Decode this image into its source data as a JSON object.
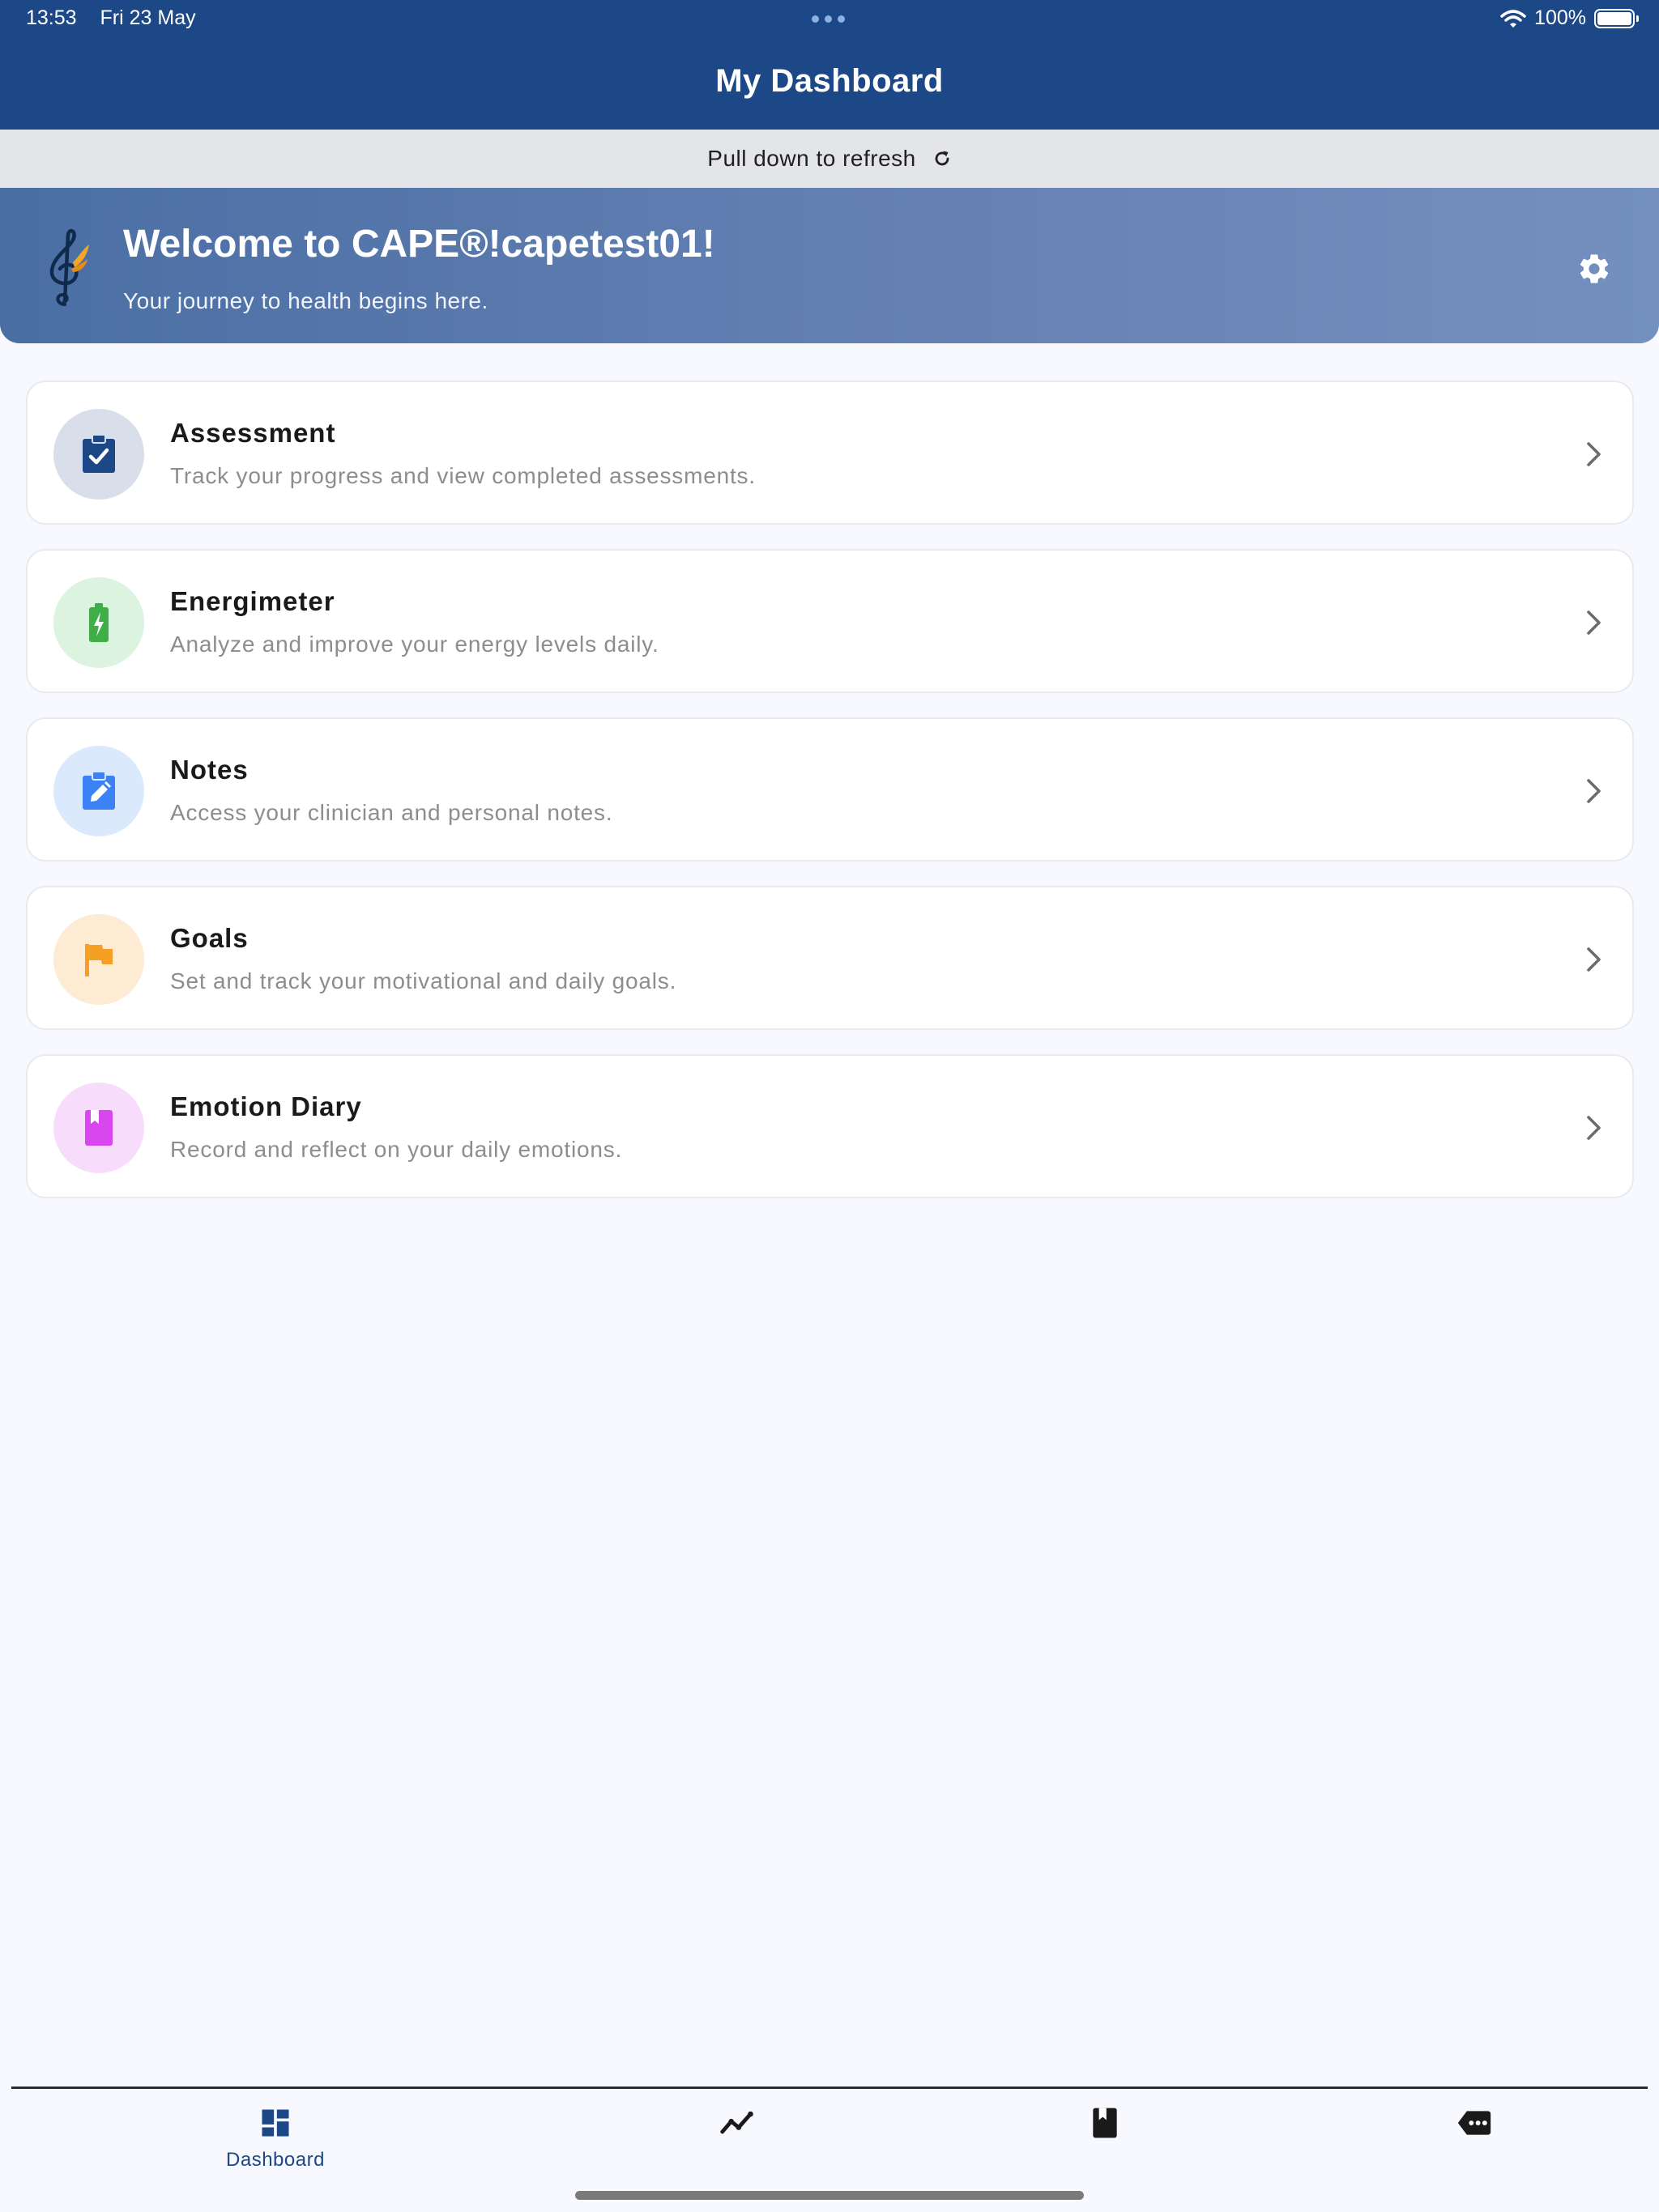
{
  "status_bar": {
    "time": "13:53",
    "date": "Fri 23 May",
    "battery": "100%"
  },
  "header": {
    "title": "My Dashboard"
  },
  "refresh": {
    "label": "Pull down to refresh"
  },
  "welcome": {
    "title": "Welcome to CAPE®!capetest01!",
    "subtitle": "Your journey to health begins here."
  },
  "cards": [
    {
      "title": "Assessment",
      "description": "Track your progress and view completed assessments.",
      "icon": "clipboard-check-icon",
      "icon_color": "#1c4887",
      "bg_color": "#d8deea"
    },
    {
      "title": "Energimeter",
      "description": "Analyze and improve your energy levels daily.",
      "icon": "battery-charging-icon",
      "icon_color": "#3fae49",
      "bg_color": "#dcf3e0"
    },
    {
      "title": "Notes",
      "description": "Access your clinician and personal notes.",
      "icon": "clipboard-edit-icon",
      "icon_color": "#3b82f6",
      "bg_color": "#dbe9fd"
    },
    {
      "title": "Goals",
      "description": "Set and track your motivational and daily goals.",
      "icon": "flag-icon",
      "icon_color": "#f5a025",
      "bg_color": "#fdebd3"
    },
    {
      "title": "Emotion Diary",
      "description": "Record and reflect on your daily emotions.",
      "icon": "bookmark-book-icon",
      "icon_color": "#d946ef",
      "bg_color": "#f8dcfb"
    }
  ],
  "tabs": [
    {
      "label": "Dashboard",
      "icon": "dashboard-icon",
      "active": true
    },
    {
      "label": "",
      "icon": "chart-line-icon",
      "active": false
    },
    {
      "label": "",
      "icon": "book-icon",
      "active": false
    },
    {
      "label": "",
      "icon": "more-tag-icon",
      "active": false
    }
  ]
}
